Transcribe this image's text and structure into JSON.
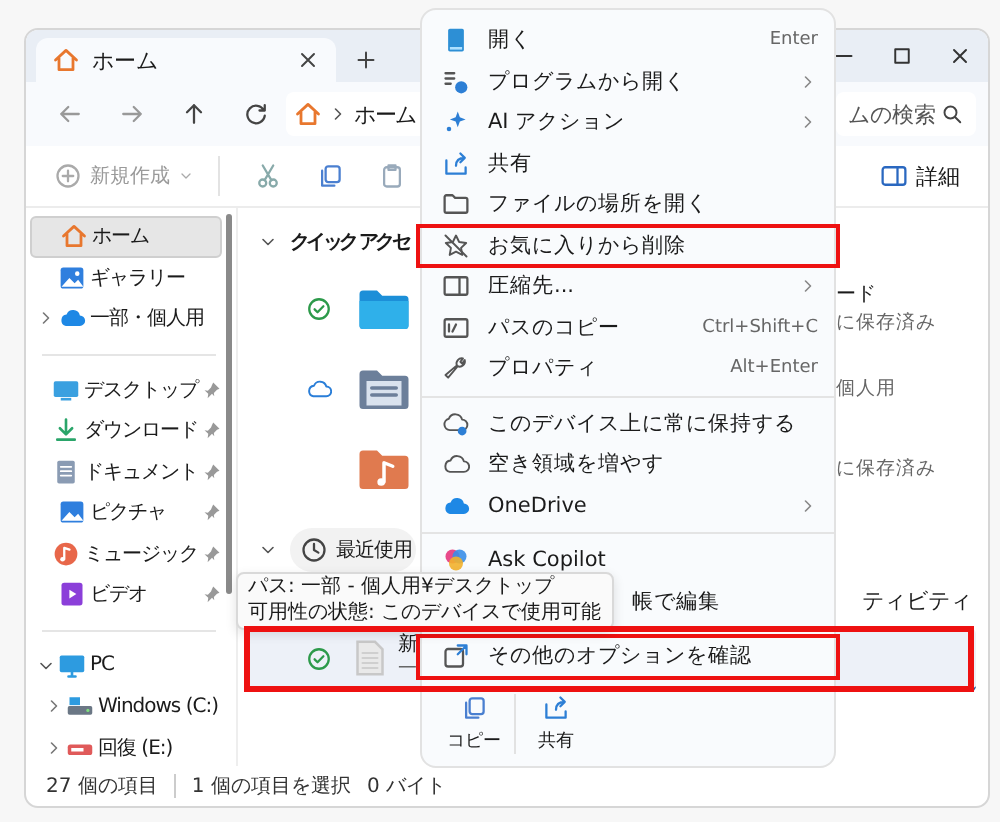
{
  "window": {
    "tabs": [
      {
        "label": "ホーム",
        "selected": true
      }
    ],
    "controls": {
      "maximized": false
    }
  },
  "address_bar": {
    "path": [
      "ホーム"
    ]
  },
  "search": {
    "placeholder": "ムの検索"
  },
  "toolbar": {
    "new_label": "新規作成",
    "new_disabled": true,
    "details_label": "詳細"
  },
  "sidebar": {
    "sections": [
      {
        "items": [
          {
            "label": "ホーム",
            "selected": true,
            "pinned": false,
            "expandable": false
          },
          {
            "label": "ギャラリー",
            "selected": false,
            "pinned": false,
            "expandable": false
          },
          {
            "label": "一部・個人用",
            "selected": false,
            "pinned": false,
            "expandable": true,
            "expanded": false
          }
        ]
      },
      {
        "items": [
          {
            "label": "デスクトップ",
            "selected": false,
            "pinned": true,
            "expandable": false
          },
          {
            "label": "ダウンロード",
            "selected": false,
            "pinned": true,
            "expandable": false
          },
          {
            "label": "ドキュメント",
            "selected": false,
            "pinned": true,
            "expandable": false
          },
          {
            "label": "ピクチャ",
            "selected": false,
            "pinned": true,
            "expandable": false
          },
          {
            "label": "ミュージック",
            "selected": false,
            "pinned": true,
            "expandable": false
          },
          {
            "label": "ビデオ",
            "selected": false,
            "pinned": true,
            "expandable": false
          }
        ]
      },
      {
        "items": [
          {
            "label": "PC",
            "selected": false,
            "pinned": false,
            "expandable": true,
            "expanded": true,
            "children": [
              {
                "label": "Windows (C:)",
                "selected": false,
                "pinned": false,
                "expandable": true,
                "expanded": false
              },
              {
                "label": "回復 (E:)",
                "selected": false,
                "pinned": false,
                "expandable": true,
                "expanded": false
              }
            ]
          }
        ]
      }
    ]
  },
  "quick_access": {
    "title": "クイック アクセ",
    "expanded": true,
    "rows": [
      {
        "kind": "synced",
        "line_1": "ード",
        "line_2": "に保存済み"
      },
      {
        "kind": "cloud",
        "line_2": "個人用"
      },
      {
        "kind": "plain",
        "line_2": "に保存済み"
      }
    ]
  },
  "recent": {
    "title": "最近使用",
    "expanded": true,
    "column_header": "ティビティ",
    "files": [
      {
        "kind": "synced",
        "name": "新",
        "detail": "一",
        "selected": true,
        "highlighted": true
      }
    ]
  },
  "tooltip": {
    "lines": [
      "パス: 一部 - 個人用¥デスクトップ",
      "可用性の状態: このデバイスで使用可能"
    ]
  },
  "context_menu": {
    "items": [
      {
        "kind": "item",
        "label": "開く",
        "shortcut": "Enter",
        "submenu": false,
        "highlighted": false
      },
      {
        "kind": "item",
        "label": "プログラムから開く",
        "submenu": true,
        "highlighted": false
      },
      {
        "kind": "item",
        "label": "AI アクション",
        "submenu": true,
        "highlighted": false
      },
      {
        "kind": "item",
        "label": "共有",
        "submenu": false,
        "highlighted": false
      },
      {
        "kind": "item",
        "label": "ファイルの場所を開く",
        "submenu": false,
        "highlighted": false
      },
      {
        "kind": "item",
        "label": "お気に入りから削除",
        "submenu": false,
        "highlighted": true
      },
      {
        "kind": "item",
        "label": "圧縮先...",
        "submenu": true,
        "highlighted": false
      },
      {
        "kind": "item",
        "label": "パスのコピー",
        "shortcut": "Ctrl+Shift+C",
        "submenu": false,
        "highlighted": false
      },
      {
        "kind": "item",
        "label": "プロパティ",
        "shortcut": "Alt+Enter",
        "submenu": false,
        "highlighted": false
      },
      {
        "kind": "separator"
      },
      {
        "kind": "item",
        "label": "このデバイス上に常に保持する",
        "submenu": false,
        "highlighted": false
      },
      {
        "kind": "item",
        "label": "空き領域を増やす",
        "submenu": false,
        "highlighted": false
      },
      {
        "kind": "item",
        "label": "OneDrive",
        "submenu": true,
        "highlighted": false
      },
      {
        "kind": "separator"
      },
      {
        "kind": "item",
        "label": "Ask Copilot",
        "submenu": false,
        "highlighted": false
      },
      {
        "kind": "item",
        "label": "帳で編集",
        "submenu": false,
        "highlighted": false,
        "covered_by_tooltip": true
      },
      {
        "kind": "separator"
      },
      {
        "kind": "item",
        "label": "その他のオプションを確認",
        "submenu": false,
        "highlighted": true
      }
    ],
    "bottom_actions": [
      {
        "label": "コピー"
      },
      {
        "label": "共有"
      }
    ]
  },
  "status_bar": {
    "item_count": "27 個の項目",
    "selection": "1 個の項目を選択",
    "size": "0 バイト"
  }
}
